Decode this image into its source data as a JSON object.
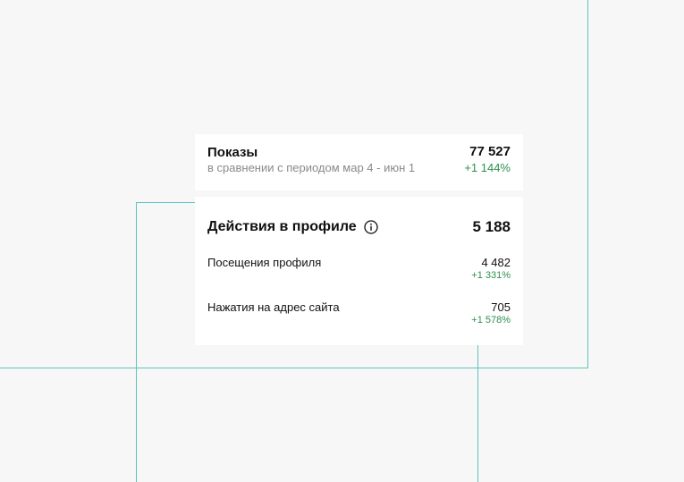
{
  "impressions": {
    "title": "Показы",
    "comparison": "в сравнении с периодом мар 4 - июн 1",
    "value": "77 527",
    "change": "+1 144%"
  },
  "profile_actions": {
    "title": "Действия в профиле",
    "info_icon": "info-icon",
    "value": "5 188",
    "rows": [
      {
        "label": "Посещения профиля",
        "value": "4 482",
        "change": "+1 331%"
      },
      {
        "label": "Нажатия на адрес сайта",
        "value": "705",
        "change": "+1 578%"
      }
    ]
  },
  "colors": {
    "positive": "#2f8f4e",
    "guide_line": "#5fc4be",
    "background": "#f7f7f7"
  }
}
